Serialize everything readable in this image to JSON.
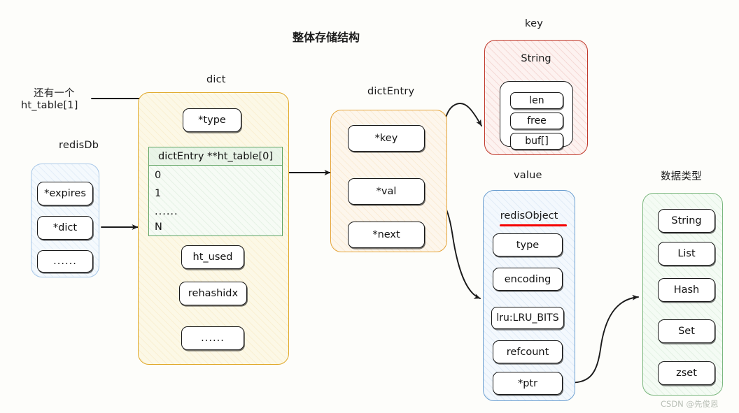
{
  "diagram": {
    "title": "整体存储结构",
    "watermark": "CSDN @先俊恩"
  },
  "notes": {
    "ht_table_note_line1": "还有一个",
    "ht_table_note_line2": "ht_table[1]"
  },
  "redisdb": {
    "label": "redisDb",
    "fields": [
      "*expires",
      "*dict",
      "......"
    ]
  },
  "dict": {
    "label": "dict",
    "type_field": "*type",
    "table": {
      "header": "dictEntry **ht_table[0]",
      "rows": [
        "0",
        "1",
        "......",
        "N"
      ]
    },
    "fields": [
      "ht_used",
      "rehashidx",
      "......"
    ]
  },
  "dictentry": {
    "label": "dictEntry",
    "fields": [
      "*key",
      "*val",
      "*next"
    ]
  },
  "key": {
    "label": "key",
    "inner_title": "String",
    "fields": [
      "len",
      "free",
      "buf[]"
    ]
  },
  "value": {
    "label": "value",
    "inner_title": "redisObject",
    "fields": [
      "type",
      "encoding",
      "lru:LRU_BITS",
      "refcount",
      "*ptr"
    ]
  },
  "datatypes": {
    "label": "数据类型",
    "items": [
      "String",
      "List",
      "Hash",
      "Set",
      "zset"
    ]
  },
  "colors": {
    "dict_border": "#e0a92a",
    "dictentry_border": "#e5a43a",
    "redisdb_border": "#a9c8e8",
    "key_border": "#c0392b",
    "value_border": "#6c9fd0",
    "types_border": "#7bb77e",
    "table_border": "#5fa463",
    "underline": "#f50000",
    "arrow": "#1a1a1a"
  }
}
